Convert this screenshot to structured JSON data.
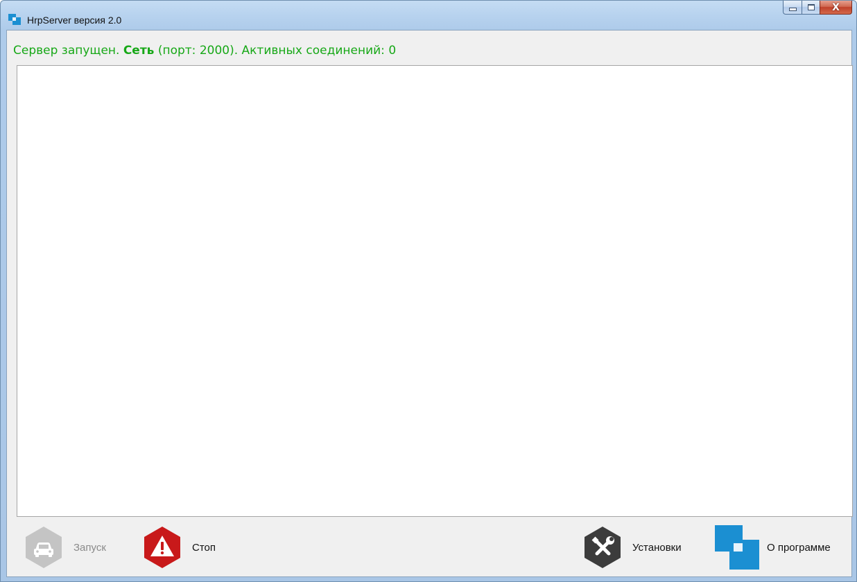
{
  "window": {
    "title": "HrpServer версия 2.0",
    "controls": {
      "minimize": "minimize",
      "maximize": "maximize",
      "close": "X"
    }
  },
  "status": {
    "prefix": "Сервер запущен. ",
    "network": "Сеть",
    "suffix": " (порт: 2000). Активных соединений: 0",
    "color": "#17a817"
  },
  "log": {
    "lines": []
  },
  "toolbar": {
    "start": {
      "label": "Запуск",
      "icon": "car-icon",
      "enabled": false
    },
    "stop": {
      "label": "Стоп",
      "icon": "warning-icon",
      "enabled": true
    },
    "settings": {
      "label": "Установки",
      "icon": "wrench-screwdriver-icon",
      "enabled": true
    },
    "about": {
      "label": "О программе",
      "icon": "app-logo-icon",
      "enabled": true
    }
  },
  "colors": {
    "stop_red": "#c8191a",
    "settings_dark": "#3c3c3c",
    "about_blue": "#1b8fd2",
    "disabled_gray": "#c4c4c4"
  }
}
